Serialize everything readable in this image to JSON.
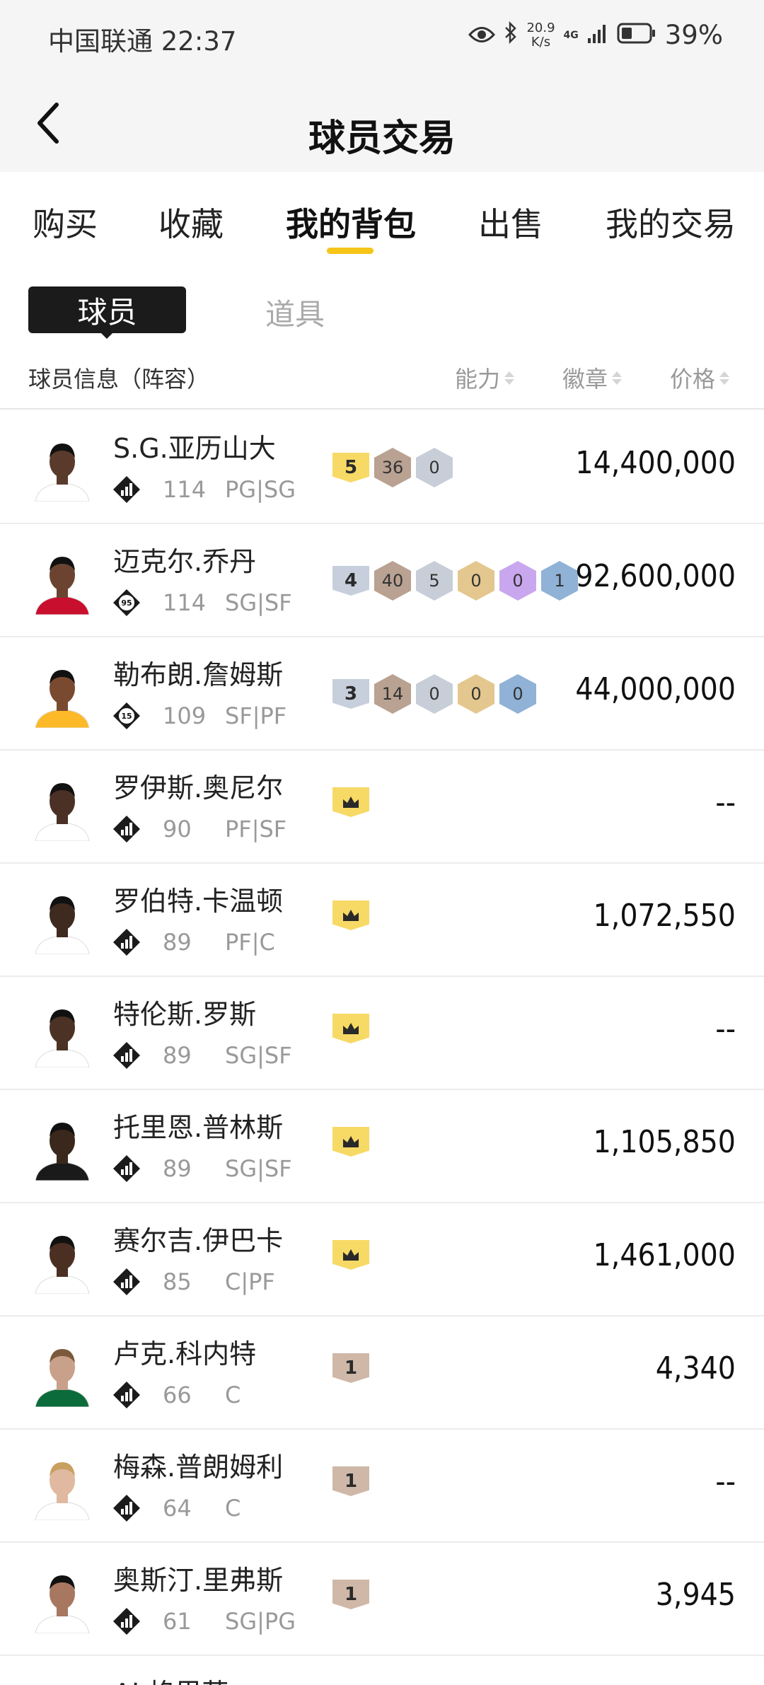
{
  "status_bar": {
    "carrier": "中国联通",
    "time": "22:37",
    "speed_value": "20.9",
    "speed_unit": "K/s",
    "network": "4G",
    "battery": "39%"
  },
  "navbar": {
    "title": "球员交易"
  },
  "tabs": [
    {
      "label": "购买"
    },
    {
      "label": "收藏"
    },
    {
      "label": "我的背包"
    },
    {
      "label": "出售"
    },
    {
      "label": "我的交易"
    }
  ],
  "segment": {
    "players": "球员",
    "items": "道具"
  },
  "list_header": {
    "info": "球员信息（阵容）",
    "ability": "能力",
    "badges": "徽章",
    "price": "价格"
  },
  "players": [
    {
      "name": "S.G.亚历山大",
      "ovr_icon": "chart",
      "score": "114",
      "position": "PG|SG",
      "tier": "5",
      "tier_color": "gold",
      "badges": [
        "36",
        "0"
      ],
      "badge_colors": [
        "brown",
        "grey"
      ],
      "price": "14,400,000"
    },
    {
      "name": "迈克尔.乔丹",
      "ovr_icon": "95",
      "score": "114",
      "position": "SG|SF",
      "tier": "4",
      "tier_color": "silver",
      "badges": [
        "40",
        "5",
        "0",
        "0",
        "1"
      ],
      "badge_colors": [
        "brown",
        "grey",
        "gold",
        "purple",
        "blue"
      ],
      "price": "92,600,000"
    },
    {
      "name": "勒布朗.詹姆斯",
      "ovr_icon": "15",
      "score": "109",
      "position": "SF|PF",
      "tier": "3",
      "tier_color": "silver",
      "badges": [
        "14",
        "0",
        "0",
        "0"
      ],
      "badge_colors": [
        "brown",
        "grey",
        "gold",
        "blue"
      ],
      "price": "44,000,000"
    },
    {
      "name": "罗伊斯.奥尼尔",
      "ovr_icon": "chart",
      "score": "90",
      "position": "PF|SF",
      "tier": "crown",
      "tier_color": "gold",
      "badges": [],
      "badge_colors": [],
      "price": "--"
    },
    {
      "name": "罗伯特.卡温顿",
      "ovr_icon": "chart",
      "score": "89",
      "position": "PF|C",
      "tier": "crown",
      "tier_color": "gold",
      "badges": [],
      "badge_colors": [],
      "price": "1,072,550"
    },
    {
      "name": "特伦斯.罗斯",
      "ovr_icon": "chart",
      "score": "89",
      "position": "SG|SF",
      "tier": "crown",
      "tier_color": "gold",
      "badges": [],
      "badge_colors": [],
      "price": "--"
    },
    {
      "name": "托里恩.普林斯",
      "ovr_icon": "chart",
      "score": "89",
      "position": "SG|SF",
      "tier": "crown",
      "tier_color": "gold",
      "badges": [],
      "badge_colors": [],
      "price": "1,105,850"
    },
    {
      "name": "赛尔吉.伊巴卡",
      "ovr_icon": "chart",
      "score": "85",
      "position": "C|PF",
      "tier": "crown",
      "tier_color": "gold",
      "badges": [],
      "badge_colors": [],
      "price": "1,461,000"
    },
    {
      "name": "卢克.科内特",
      "ovr_icon": "chart",
      "score": "66",
      "position": "C",
      "tier": "1",
      "tier_color": "bronze",
      "badges": [],
      "badge_colors": [],
      "price": "4,340"
    },
    {
      "name": "梅森.普朗姆利",
      "ovr_icon": "chart",
      "score": "64",
      "position": "C",
      "tier": "1",
      "tier_color": "bronze",
      "badges": [],
      "badge_colors": [],
      "price": "--"
    },
    {
      "name": "奥斯汀.里弗斯",
      "ovr_icon": "chart",
      "score": "61",
      "position": "SG|PG",
      "tier": "1",
      "tier_color": "bronze",
      "badges": [],
      "badge_colors": [],
      "price": "3,945"
    }
  ],
  "partial_row": {
    "name": "AJ.格里芬"
  }
}
